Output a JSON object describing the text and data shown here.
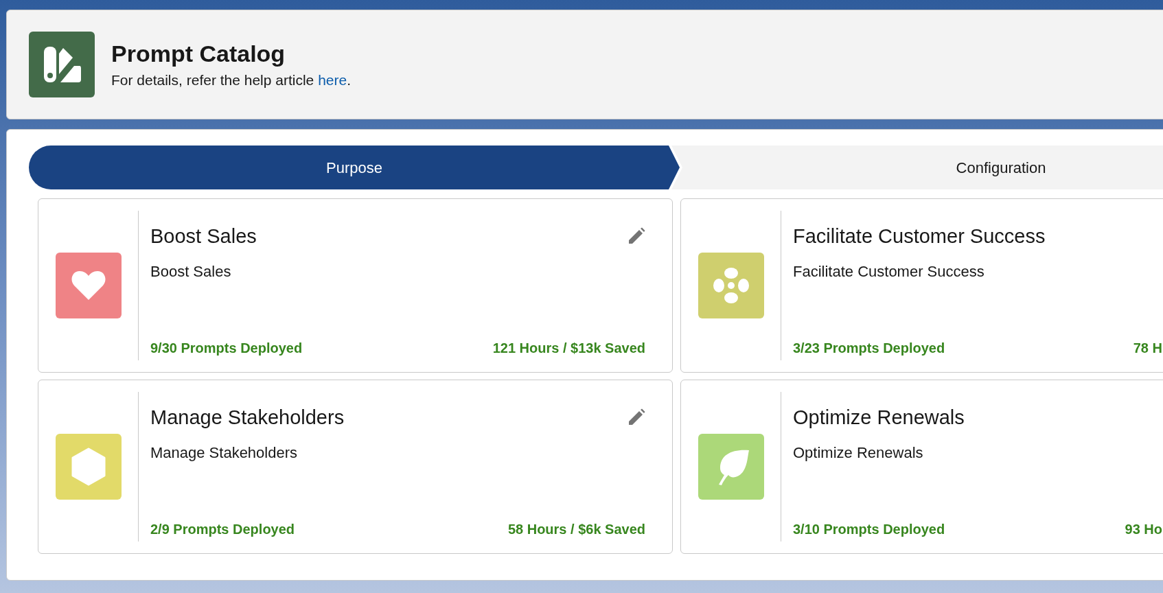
{
  "header": {
    "title": "Prompt Catalog",
    "subtitle": "For details, refer the help article ",
    "link": "here",
    "subtitle_end": "."
  },
  "steps": [
    {
      "label": "Purpose",
      "selected": true
    },
    {
      "label": "Configuration",
      "selected": false
    }
  ],
  "purposes": [
    {
      "title": "Boost Sales",
      "description": "Boost Sales",
      "kind": "heart",
      "color": "#ef8386",
      "deployed": "9/30 Prompts Deployed",
      "savings": "121 Hours / $13k Saved",
      "editable": true
    },
    {
      "title": "Facilitate Customer Success",
      "description": "Facilitate Customer Success",
      "kind": "fan",
      "color": "#cfcf6e",
      "deployed": "3/23 Prompts Deployed",
      "savings": "78 H"
    },
    {
      "title": "Manage Stakeholders",
      "description": "Manage Stakeholders",
      "kind": "hexagon",
      "color": "#e2da69",
      "deployed": "2/9 Prompts Deployed",
      "savings": "58 Hours / $6k Saved",
      "editable": true
    },
    {
      "title": "Optimize Renewals",
      "description": "Optimize Renewals",
      "kind": "leaf",
      "color": "#acd879",
      "deployed": "3/10 Prompts Deployed",
      "savings": "93 Ho"
    }
  ]
}
